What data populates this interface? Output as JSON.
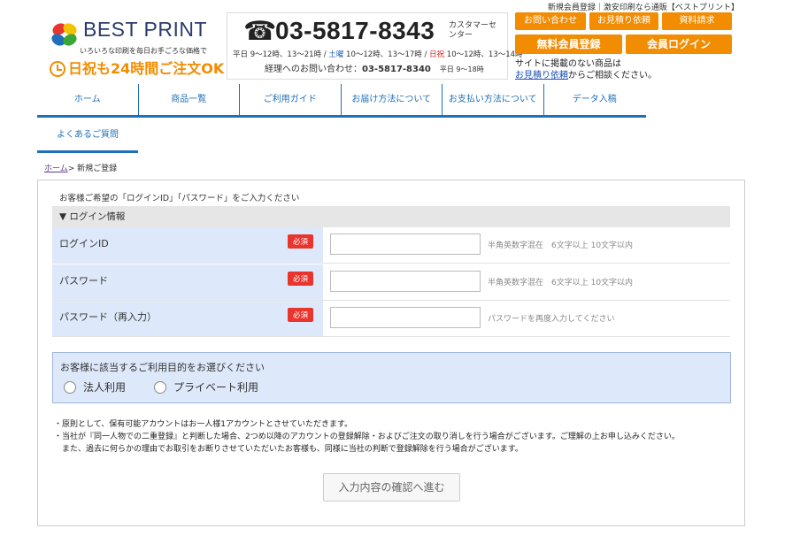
{
  "header": {
    "tagline": "新規会員登録｜激安印刷なら通販【ベストプリント】",
    "logo": {
      "name": "BEST PRINT",
      "sub": "いろいろな印刷を毎日お手ごろな価格で",
      "hours": "日祝も24時間ご注文OK"
    },
    "phone": {
      "number": "03-5817-8343",
      "label": "カスタマーセンター",
      "hours_prefix": "平日 9〜12時、13〜21時 / ",
      "hours_sat": "土曜",
      "hours_mid": " 10〜12時、13〜17時 / ",
      "hours_sun": "日祝",
      "hours_suffix": " 10〜12時、13〜14時",
      "acct_prefix": "経理へのお問い合わせ：",
      "acct_number": "03-5817-8340",
      "acct_hours": "平日 9〜18時"
    },
    "buttons": {
      "contact": "お問い合わせ",
      "estimate": "お見積り依頼",
      "docs": "資料請求",
      "register": "無料会員登録",
      "login": "会員ログイン"
    },
    "side_note": {
      "line1": "サイトに掲載のない商品は",
      "link": "お見積り依頼",
      "line2_suffix": "からご相談ください。"
    }
  },
  "nav": {
    "items": [
      "ホーム",
      "商品一覧",
      "ご利用ガイド",
      "お届け方法について",
      "お支払い方法について",
      "データ入稿"
    ],
    "faq": "よくあるご質問"
  },
  "breadcrumb": {
    "home": "ホーム",
    "sep": "> ",
    "current": "新規ご登録"
  },
  "form": {
    "intro": "お客様ご希望の「ログインID」「パスワード」をご入力ください",
    "section_title": "▼ ログイン情報",
    "required_label": "必須",
    "rows": [
      {
        "label": "ログインID",
        "value": "",
        "hint": "半角英数字混在　6文字以上 10文字以内"
      },
      {
        "label": "パスワード",
        "value": "",
        "hint": "半角英数字混在　6文字以上 10文字以内"
      },
      {
        "label": "パスワード（再入力）",
        "value": "",
        "hint": "パスワードを再度入力してください"
      }
    ],
    "purpose": {
      "title": "お客様に該当するご利用目的をお選びください",
      "options": [
        "法人利用",
        "プライベート利用"
      ]
    },
    "notes": [
      "・原則として、保有可能アカウントはお一人様1アカウントとさせていただきます。",
      "・当社が『同一人物での二重登録』と判断した場合、2つめ以降のアカウントの登録解除・およびご注文の取り消しを行う場合がございます。ご理解の上お申し込みください。",
      "　また、過去に何らかの理由でお取引をお断りさせていただいたお客様も、同様に当社の判断で登録解除を行う場合がございます。"
    ],
    "submit": "入力内容の確認へ進む"
  },
  "colors": {
    "accent": "#f28c00",
    "nav": "#1f6fb9",
    "required": "#e8352e",
    "row_bg": "#dde9fa"
  }
}
